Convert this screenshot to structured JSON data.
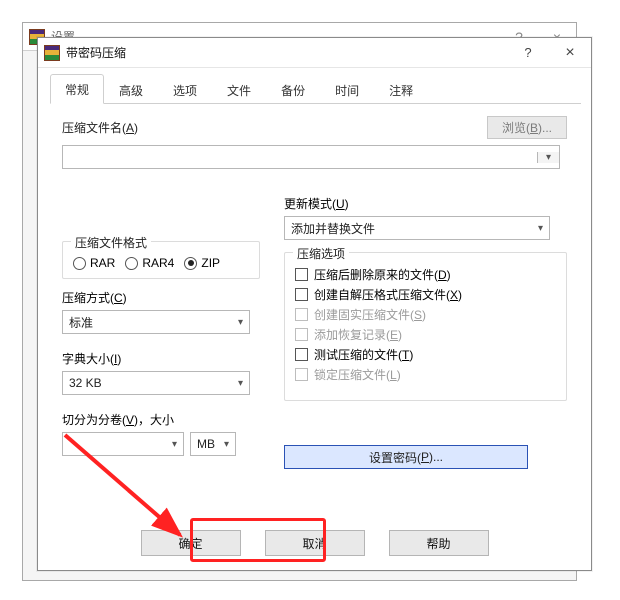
{
  "back_window": {
    "title": "设置"
  },
  "dialog": {
    "title": "带密码压缩",
    "help_icon": "?",
    "close_icon": "×",
    "tabs": [
      "常规",
      "高级",
      "选项",
      "文件",
      "备份",
      "时间",
      "注释"
    ],
    "active_tab": 0,
    "filename_label": "压缩文件名(<u>A</u>)",
    "browse_label": "浏览(<u>B</u>)...",
    "update_mode_label": "更新模式(<u>U</u>)",
    "update_mode_value": "添加并替换文件",
    "format_group": "压缩文件格式",
    "formats": [
      {
        "label": "RAR",
        "sel": false
      },
      {
        "label": "RAR4",
        "sel": false
      },
      {
        "label": "ZIP",
        "sel": true
      }
    ],
    "method_label": "压缩方式(<u>C</u>)",
    "method_value": "标准",
    "dict_label": "字典大小(<u>I</u>)",
    "dict_value": "32 KB",
    "split_label": "切分为分卷(<u>V</u>)，大小",
    "split_unit": "MB",
    "options_group": "压缩选项",
    "options": [
      {
        "label": "压缩后删除原来的文件(<u>D</u>)",
        "disabled": false
      },
      {
        "label": "创建自解压格式压缩文件(<u>X</u>)",
        "disabled": false
      },
      {
        "label": "创建固实压缩文件(<u>S</u>)",
        "disabled": true
      },
      {
        "label": "添加恢复记录(<u>E</u>)",
        "disabled": true
      },
      {
        "label": "测试压缩的文件(<u>T</u>)",
        "disabled": false
      },
      {
        "label": "锁定压缩文件(<u>L</u>)",
        "disabled": true
      }
    ],
    "password_btn": "设置密码(<u>P</u>)...",
    "ok": "确定",
    "cancel": "取消",
    "help": "帮助"
  }
}
